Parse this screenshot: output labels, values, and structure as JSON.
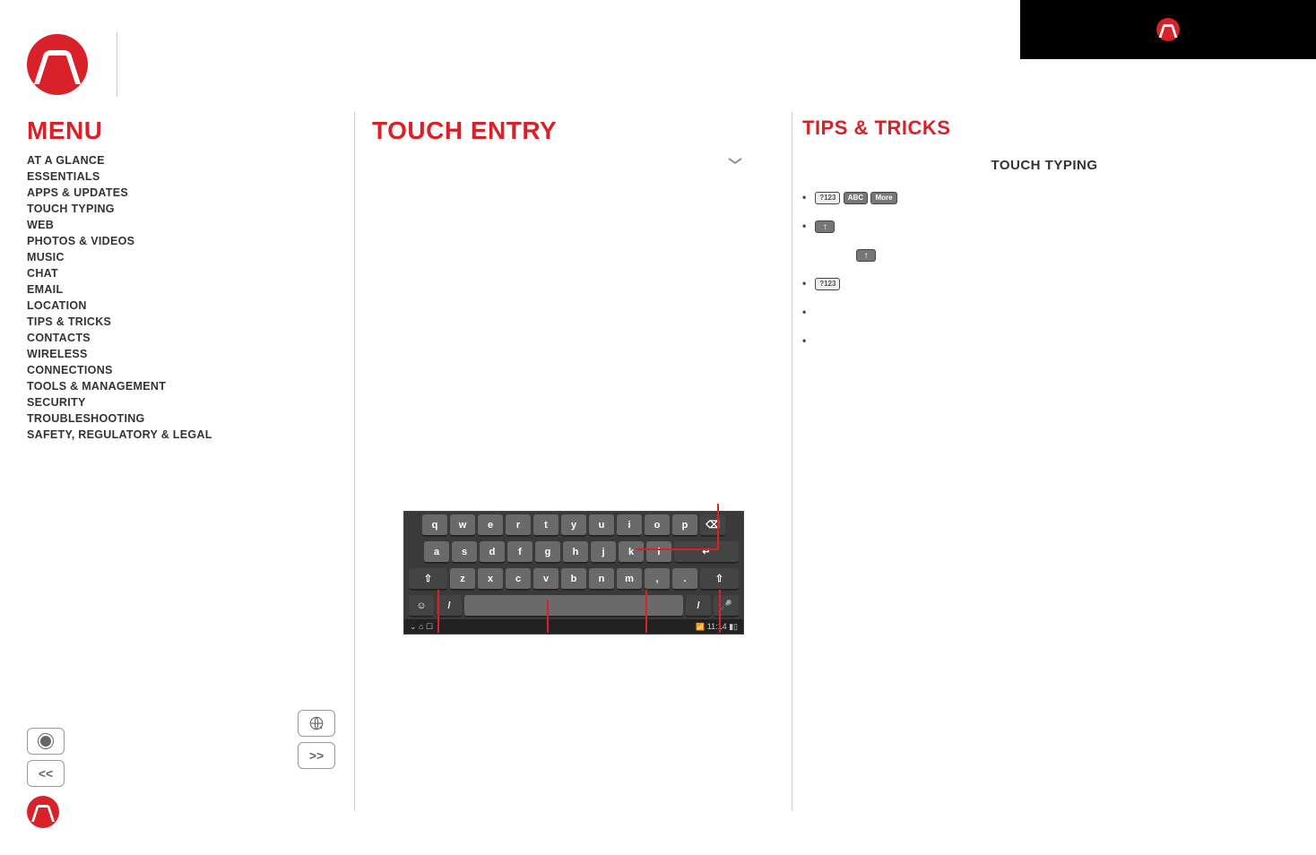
{
  "brand": "Motorola",
  "menu": {
    "title": "MENU",
    "items": [
      "AT A GLANCE",
      "ESSENTIALS",
      "APPS & UPDATES",
      "TOUCH TYPING",
      "WEB",
      "PHOTOS & VIDEOS",
      "MUSIC",
      "CHAT",
      "EMAIL",
      "LOCATION",
      "TIPS & TRICKS",
      "CONTACTS",
      "WIRELESS",
      "CONNECTIONS",
      "TOOLS & MANAGEMENT",
      "SECURITY",
      "TROUBLESHOOTING",
      "SAFETY, REGULATORY & LEGAL"
    ]
  },
  "center": {
    "title": "TOUCH ENTRY",
    "keyboard": {
      "row1": [
        "q",
        "w",
        "e",
        "r",
        "t",
        "y",
        "u",
        "i",
        "o",
        "p",
        "⌫"
      ],
      "row2": [
        "a",
        "s",
        "d",
        "f",
        "g",
        "h",
        "j",
        "k",
        "l",
        "↵"
      ],
      "row3": [
        "⇧",
        "z",
        "x",
        "c",
        "v",
        "b",
        "n",
        "m",
        ",",
        ".",
        "⇧"
      ],
      "row4_left": "☺",
      "row4_lang": "/",
      "row4_voiceR": "🎤",
      "statusbar_time": "11:14"
    }
  },
  "right": {
    "title": "TIPS & TRICKS",
    "heading": "TOUCH TYPING",
    "key_7123": "?123",
    "key_abc": "ABC",
    "key_more": "More"
  },
  "nav": {
    "back": "<<",
    "fwd": ">>"
  }
}
